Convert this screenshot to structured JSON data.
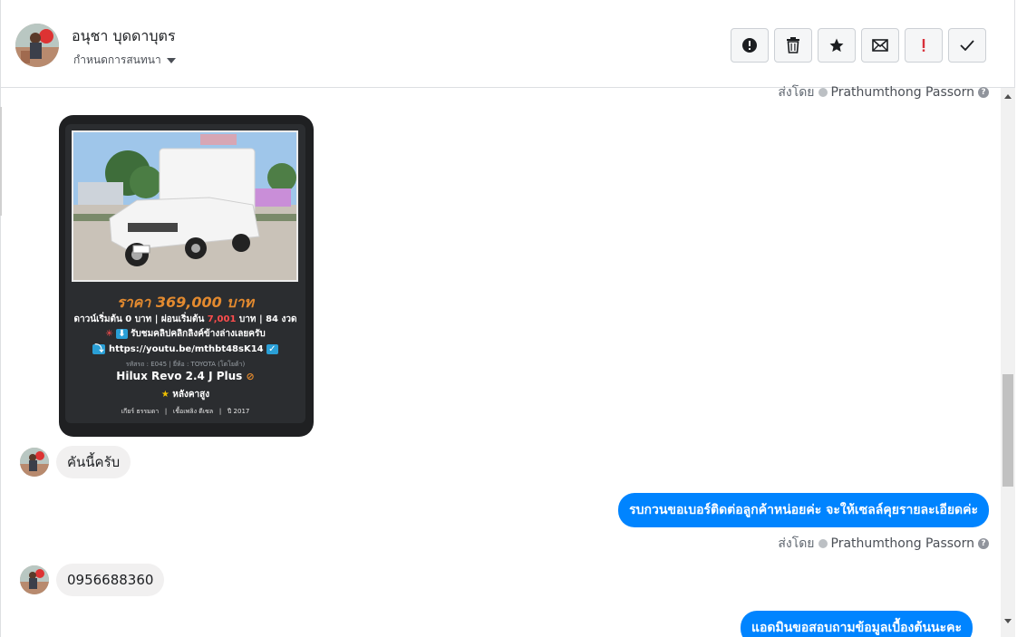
{
  "header": {
    "contact_name": "อนุชา บุดดาบุตร",
    "assign_label": "กำหนดการสนทนา"
  },
  "actions": [
    {
      "name": "spam-button",
      "icon": "alert-circle-icon"
    },
    {
      "name": "delete-button",
      "icon": "trash-icon"
    },
    {
      "name": "star-button",
      "icon": "star-icon"
    },
    {
      "name": "mark-unread-button",
      "icon": "envelope-icon"
    },
    {
      "name": "follow-up-button",
      "icon": "exclamation-icon"
    },
    {
      "name": "mark-done-button",
      "icon": "check-icon"
    }
  ],
  "sent_by": {
    "prefix": "ส่งโดย",
    "name": "Prathumthong Passorn"
  },
  "card": {
    "price": "ราคา 369,000 บาท",
    "down_prefix": "ดาวน์เริ่มต้น 0 บาท | ผ่อนเริ่มต้น",
    "installment": "7,001",
    "down_suffix": "บาท | 84 งวด",
    "clip_text": "รับชมคลิปคลิกลิงค์ข้างล่างเลยครับ",
    "url": "https://youtu.be/mthbt48sK14",
    "meta": "รหัสรถ : E045 | ยี่ห้อ : TOYOTA (โตโยต้า)",
    "model": "Hilux Revo 2.4 J Plus",
    "feature": "หลังคาสูง",
    "specs": "เกียร์ ธรรมดา   |   เชื้อเพลิง ดีเซล   |   ปี 2017"
  },
  "messages": {
    "in_1": "คันนี้ครับ",
    "out_1": "รบกวนขอเบอร์ติดต่อลูกค้าหน่อยค่ะ จะให้เซลล์คุยรายละเอียดค่ะ",
    "in_2": "0956688360",
    "out_2": "แอดมินขอสอบถามข้อมูลเบื้องต้นนะคะ"
  },
  "colors": {
    "outgoing_bubble": "#0084ff",
    "incoming_bubble": "#f1f0f0",
    "price": "#e38a2f"
  }
}
